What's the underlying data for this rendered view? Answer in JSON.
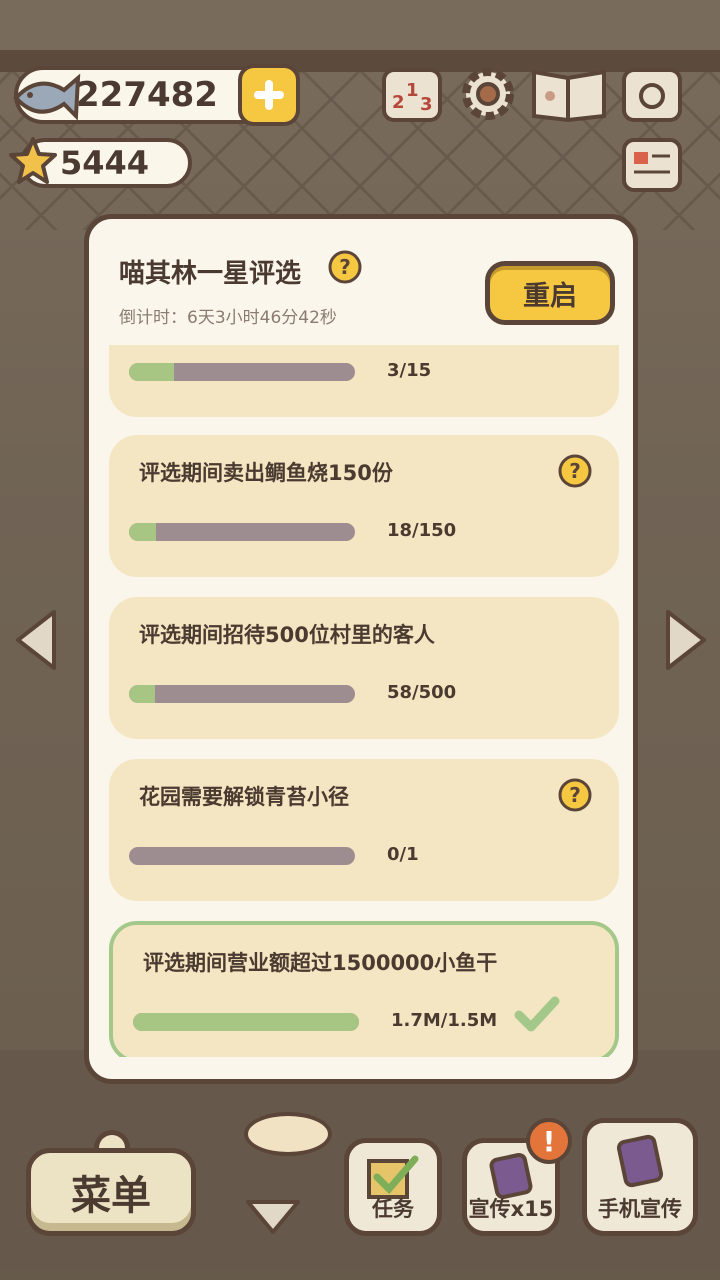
{
  "header": {
    "fish_count": "227482",
    "star_count": "5444"
  },
  "modal": {
    "title": "喵其林一星评选",
    "countdown": "倒计时：6天3小时46分42秒",
    "restart_label": "重启"
  },
  "tasks": [
    {
      "text": "",
      "count": "3/15",
      "progress": 0.2,
      "help": false,
      "done": false
    },
    {
      "text": "评选期间卖出鲷鱼烧150份",
      "count": "18/150",
      "progress": 0.12,
      "help": true,
      "done": false
    },
    {
      "text": "评选期间招待500位村里的客人",
      "count": "58/500",
      "progress": 0.116,
      "help": false,
      "done": false
    },
    {
      "text": "花园需要解锁青苔小径",
      "count": "0/1",
      "progress": 0,
      "help": true,
      "done": false
    },
    {
      "text": "评选期间营业额超过1500000小鱼干",
      "count": "1.7M/1.5M",
      "progress": 1.0,
      "help": false,
      "done": true
    }
  ],
  "bottom": {
    "menu_label": "菜单",
    "tasks_label": "任务",
    "promo_label": "宣传x15",
    "phone_promo_label": "手机宣传",
    "alert_mark": "!"
  },
  "colors": {
    "accent_yellow": "#f6c842",
    "progress_green": "#a7c683",
    "outline_brown": "#5a4538",
    "card_bg": "#f4e6c2"
  },
  "icons": [
    "fish-icon",
    "star-icon",
    "plus-icon",
    "leaderboard-icon",
    "gear-icon",
    "recipe-book-icon",
    "camera-icon",
    "newspaper-icon",
    "help-icon",
    "check-icon",
    "left-arrow-icon",
    "right-arrow-icon",
    "down-arrow-icon"
  ]
}
